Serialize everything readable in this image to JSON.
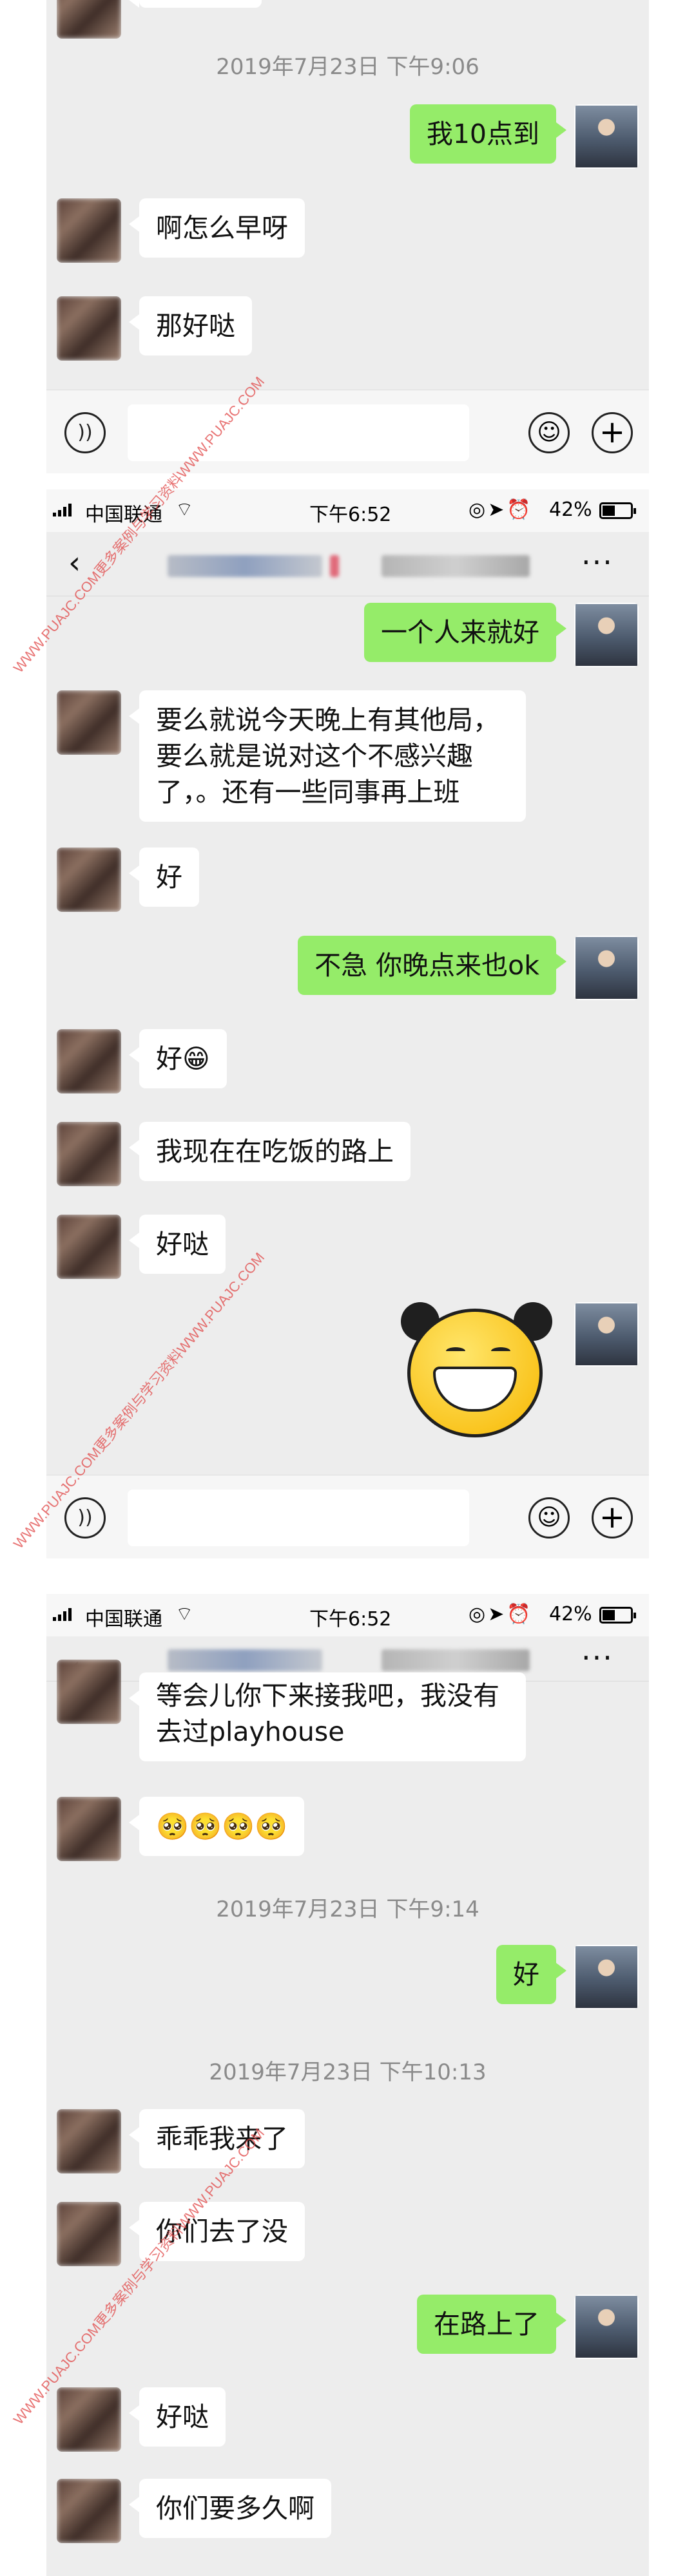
{
  "colors": {
    "bg": "#ededed",
    "my_bubble": "#95ec69",
    "their_bubble": "#ffffff",
    "timestamp": "#8a8a8a",
    "watermark": "#e04646"
  },
  "panel1": {
    "timestamp": "2019年7月23日 下午9:06",
    "messages": [
      {
        "side": "right",
        "text": "我10点到"
      },
      {
        "side": "left",
        "text": "啊怎么早呀"
      },
      {
        "side": "left",
        "text": "那好哒"
      }
    ]
  },
  "panel2": {
    "status": {
      "carrier": "中国联通",
      "time": "下午6:52",
      "battery": "42%",
      "battery_level": 0.42
    },
    "messages": [
      {
        "side": "right",
        "text": "一个人来就好"
      },
      {
        "side": "left",
        "text": "要么就说今天晚上有其他局，\n要么就是说对这个不感兴趣\n了，。还有一些同事再上班"
      },
      {
        "side": "left",
        "text": "好"
      },
      {
        "side": "right",
        "text": "不急 你晚点来也ok"
      },
      {
        "side": "left",
        "text": "好😁"
      },
      {
        "side": "left",
        "text": "我现在在吃饭的路上"
      },
      {
        "side": "left",
        "text": "好哒"
      }
    ]
  },
  "panel3": {
    "status": {
      "carrier": "中国联通",
      "time": "下午6:52",
      "battery": "42%",
      "battery_level": 0.42
    },
    "messages": [
      {
        "side": "left",
        "text": "等会儿你下来接我吧，我没有\n去过playhouse"
      },
      {
        "side": "left",
        "text": "🥺🥺🥺🥺"
      },
      {
        "side": "right",
        "text": "好"
      },
      {
        "side": "left",
        "text": "乖乖我来了"
      },
      {
        "side": "left",
        "text": "你们去了没"
      },
      {
        "side": "right",
        "text": "在路上了"
      },
      {
        "side": "left",
        "text": "好哒"
      },
      {
        "side": "left",
        "text": "你们要多久啊"
      }
    ],
    "timestamps": [
      "2019年7月23日 下午9:14",
      "2019年7月23日 下午10:13"
    ]
  },
  "icons": {
    "voice": "voice-icon",
    "emoji": "emoji-icon",
    "plus": "plus-icon",
    "back": "back-icon",
    "more": "more-icon",
    "wifi": "wifi-icon"
  },
  "watermark": "WWW.PUAJC.COM更多案例与学习资料WWW.PUAJC.COM"
}
